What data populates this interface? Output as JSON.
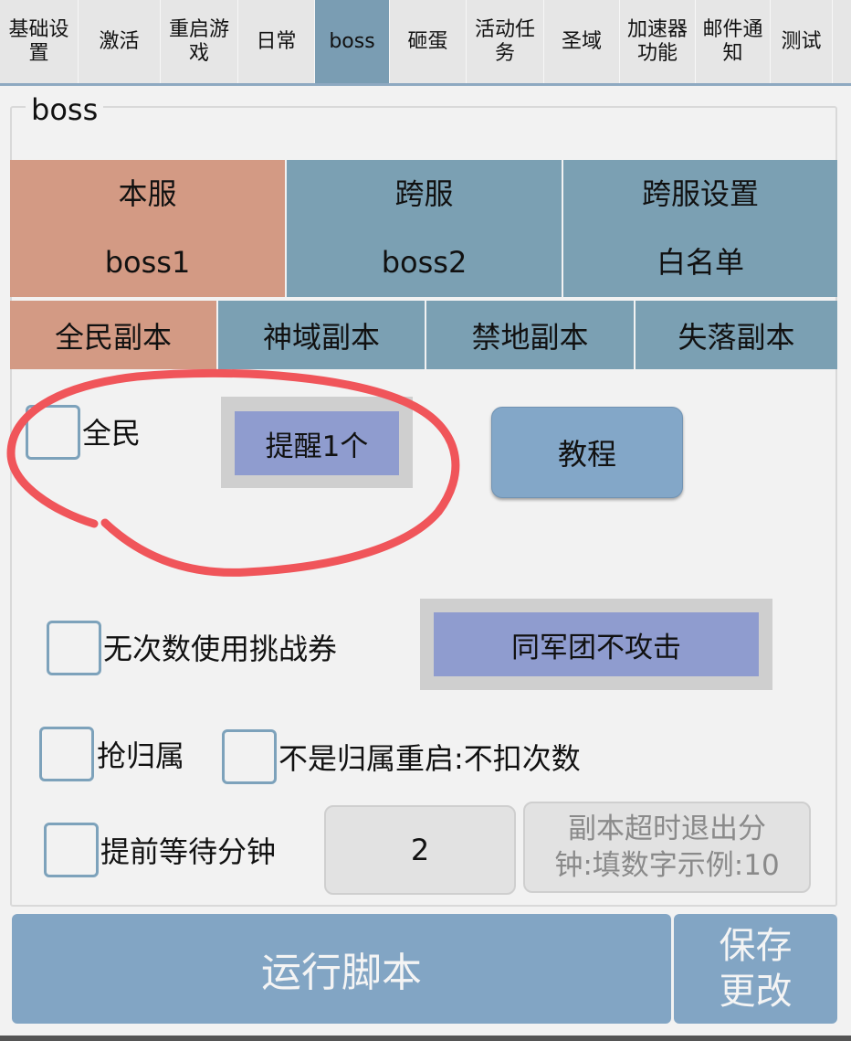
{
  "tabs": [
    {
      "label": "基础设\n置",
      "active": false
    },
    {
      "label": "激活",
      "active": false
    },
    {
      "label": "重启游\n戏",
      "active": false
    },
    {
      "label": "日常",
      "active": false
    },
    {
      "label": "boss",
      "active": true
    },
    {
      "label": "砸蛋",
      "active": false
    },
    {
      "label": "活动任\n务",
      "active": false
    },
    {
      "label": "圣域",
      "active": false
    },
    {
      "label": "加速器\n功能",
      "active": false
    },
    {
      "label": "邮件通\n知",
      "active": false
    },
    {
      "label": "测试",
      "active": false
    }
  ],
  "group_title": "boss",
  "server_tabs": [
    {
      "label": "本服",
      "sub": "boss1",
      "active": true
    },
    {
      "label": "跨服",
      "sub": "boss2",
      "active": false
    },
    {
      "label": "跨服设置",
      "sub": "白名单",
      "active": false
    }
  ],
  "dungeon_tabs": [
    {
      "label": "全民副本",
      "active": true
    },
    {
      "label": "神域副本",
      "active": false
    },
    {
      "label": "禁地副本",
      "active": false
    },
    {
      "label": "失落副本",
      "active": false
    }
  ],
  "quanmin": {
    "label": "全民",
    "checked": false
  },
  "remind_button": "提醒1个",
  "tutorial_button": "教程",
  "no_count_ticket": {
    "label": "无次数使用挑战券",
    "checked": false
  },
  "same_legion_button": "同军团不攻击",
  "grab_ownership": {
    "label": "抢归属",
    "checked": false
  },
  "not_owner_restart": {
    "label": "不是归属重启:不扣次数",
    "checked": false
  },
  "wait_minutes": {
    "label": "提前等待分钟",
    "checked": false,
    "value": "2"
  },
  "timeout_hint": "副本超时退出分\n钟:填数字示例:10",
  "run_button": "运行脚本",
  "save_button": "保存\n更改",
  "colors": {
    "active_tab": "#7a9db3",
    "salmon": "#d39a84",
    "steel": "#7ba0b3",
    "annotation": "#f0555a",
    "purple_button": "#8f9ccf"
  }
}
